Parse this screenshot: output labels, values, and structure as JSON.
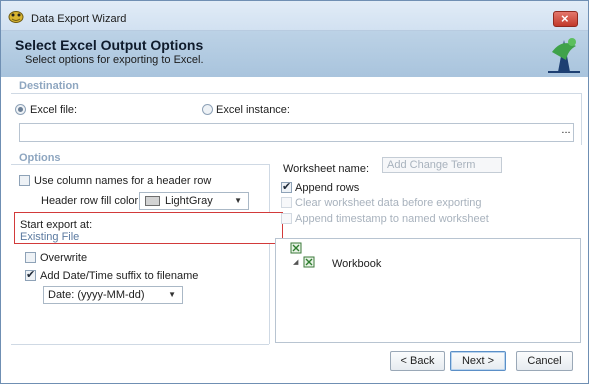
{
  "window": {
    "title": "Data Export Wizard",
    "close_glyph": "×"
  },
  "header": {
    "title": "Select Excel Output Options",
    "subtitle": "Select options for exporting to Excel."
  },
  "destination": {
    "label": "Destination",
    "excel_file_label": "Excel file:",
    "excel_file_selected": true,
    "excel_instance_label": "Excel instance:",
    "path_value": "",
    "browse_label": "..."
  },
  "options": {
    "label": "Options",
    "use_column_names_label": "Use column names for a header row",
    "use_column_names_checked": false,
    "header_fill_label": "Header row fill color:",
    "header_fill_value": "LightGray",
    "header_fill_swatch": "#d3d3d3",
    "start_export_label": "Start export at:",
    "start_export_value": "Existing File",
    "overwrite_label": "Overwrite",
    "overwrite_checked": false,
    "add_suffix_label": "Add Date/Time suffix to filename",
    "add_suffix_checked": true,
    "date_format_value": "Date: (yyyy-MM-dd)"
  },
  "worksheet": {
    "name_label": "Worksheet name:",
    "name_placeholder": "Add Change Term",
    "append_rows_label": "Append rows",
    "append_rows_checked": true,
    "clear_data_label": "Clear worksheet data before exporting",
    "append_timestamp_label": "Append timestamp to named worksheet"
  },
  "tree": {
    "root_expander": "◢",
    "workbook_label": "Workbook"
  },
  "buttons": {
    "back": "< Back",
    "next": "Next >",
    "cancel": "Cancel"
  },
  "colors": {
    "accent": "#5b8fc7",
    "highlight_border": "#d23a3a",
    "section_label": "#8ea6c0"
  }
}
